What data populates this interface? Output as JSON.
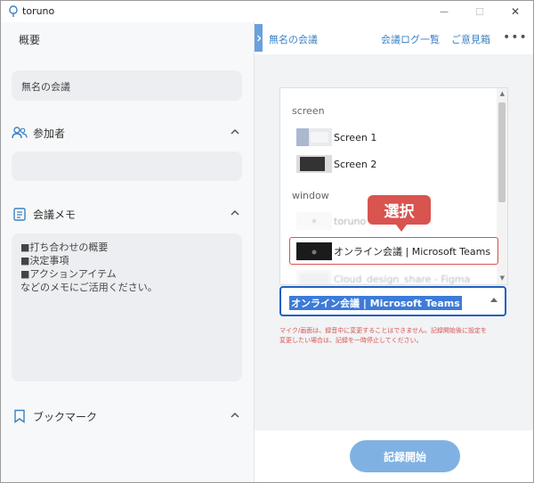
{
  "app": {
    "name": "toruno",
    "window_controls": {
      "minimize": "—",
      "maximize": "☐",
      "close": "✕"
    }
  },
  "left_panel": {
    "overview_label": "概要",
    "meeting_name_value": "無名の会議",
    "participants": {
      "label": "参加者",
      "icon": "people-icon"
    },
    "memo": {
      "label": "会議メモ",
      "icon": "document-icon",
      "placeholder_lines": [
        "■打ち合わせの概要",
        "■決定事項",
        "■アクションアイテム",
        "などのメモにご活用ください。"
      ]
    },
    "bookmark": {
      "label": "ブックマーク",
      "icon": "bookmark-icon"
    }
  },
  "right_panel": {
    "meeting_title": "無名の会議",
    "links": {
      "log_list": "会議ログ一覧",
      "feedback": "ご意見箱"
    },
    "more": "•••",
    "source_list": {
      "groups": [
        {
          "title": "screen",
          "items": [
            "Screen 1",
            "Screen 2"
          ]
        },
        {
          "title": "window",
          "items": [
            "toruno",
            "オンライン会議 | Microsoft Teams",
            "Cloud_design_share - Figma"
          ]
        }
      ]
    },
    "callout": "選択",
    "selected_source": "オンライン会議 | Microsoft Teams",
    "warning_lines": [
      "マイク/画面は、録音中に変更することはできません。記録開始後に設定を",
      "変更したい場合は、記録を一時停止してください。"
    ],
    "start_button": "記録開始"
  },
  "colors": {
    "accent_blue": "#3b82c4",
    "highlight_red": "#d9534f",
    "button_blue": "#7fb2e2",
    "select_border": "#1f5fbf"
  }
}
